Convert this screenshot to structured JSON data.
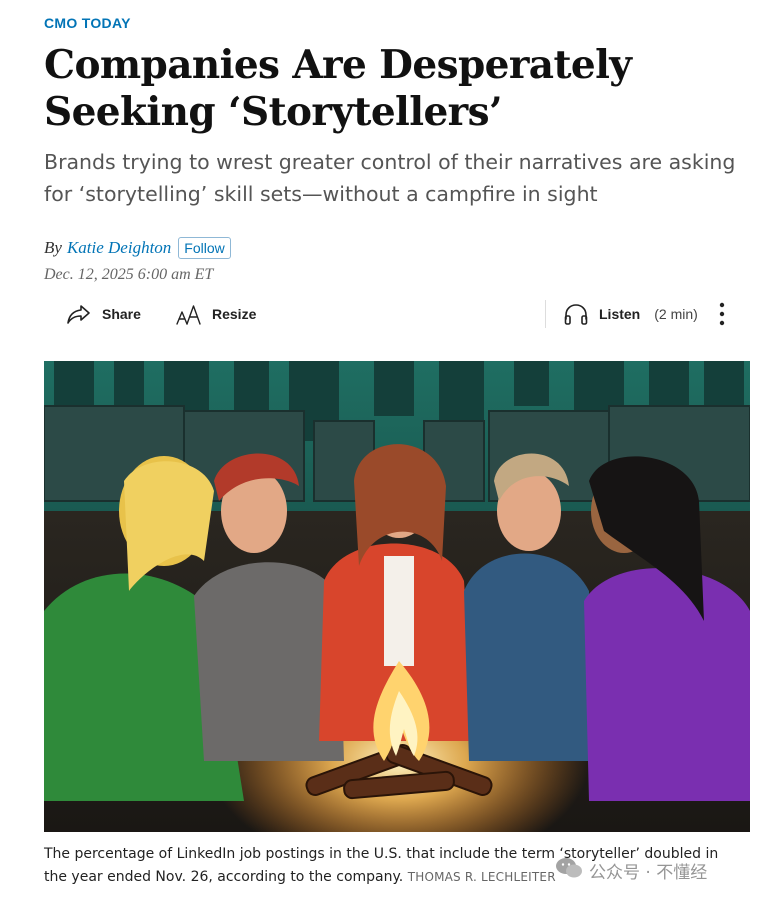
{
  "section": {
    "label": "CMO TODAY"
  },
  "article": {
    "headline": "Companies Are Desperately Seeking ‘Storytellers’",
    "dek": "Brands trying to wrest greater control of their narratives are asking for ‘storytelling’ skill sets—without a campfire in sight",
    "byline_prefix": "By",
    "author": "Katie Deighton",
    "follow_label": "Follow",
    "date": "Dec. 12, 2025 6:00 am ET"
  },
  "toolbar": {
    "share_label": "Share",
    "share_icon": "share-arrow-icon",
    "resize_label": "Resize",
    "resize_icon": "text-size-icon",
    "listen_label": "Listen",
    "listen_icon": "headphones-icon",
    "listen_duration": "(2 min)",
    "more_icon": "more-vertical-icon"
  },
  "image": {
    "caption": "The percentage of LinkedIn job postings in the U.S. that include the term ‘storyteller’ doubled in the year ended Nov. 26, according to the company.",
    "credit": "THOMAS R. LECHLEITER"
  },
  "watermark": {
    "text": "公众号 · 不懂经"
  },
  "colors": {
    "accent": "#0274b6",
    "headline": "#111111",
    "dek": "#555555",
    "illustration_teal": "#1e6b60",
    "fire": "#ffb347"
  }
}
